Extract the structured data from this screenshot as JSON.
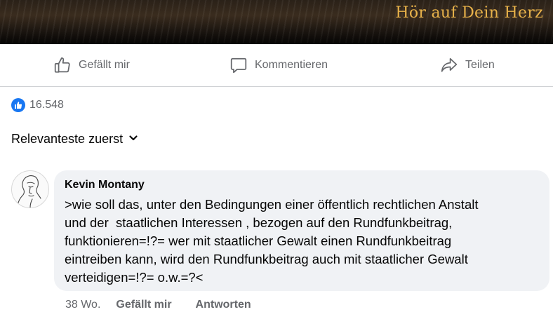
{
  "banner": {
    "text": "Hör auf Dein Herz"
  },
  "actions": {
    "like_label": "Gefällt mir",
    "comment_label": "Kommentieren",
    "share_label": "Teilen"
  },
  "reactions": {
    "count": "16.548",
    "accent": "#1877f2"
  },
  "sort": {
    "label": "Relevanteste zuerst"
  },
  "comment": {
    "author": "Kevin Montany",
    "text": ">wie soll das, unter den Bedingungen einer öffentlich rechtlichen Anstalt\nund der  staatlichen Interessen , bezogen auf den Rundfunkbeitrag,\nfunktionieren=!?= wer mit staatlicher Gewalt einen Rundfunkbeitrag\neintreiben kann, wird den Rundfunkbeitrag auch mit staatlicher Gewalt\nverteidigen=!?= o.w.=?<",
    "time": "38 Wo.",
    "like_label": "Gefällt mir",
    "reply_label": "Antworten"
  }
}
